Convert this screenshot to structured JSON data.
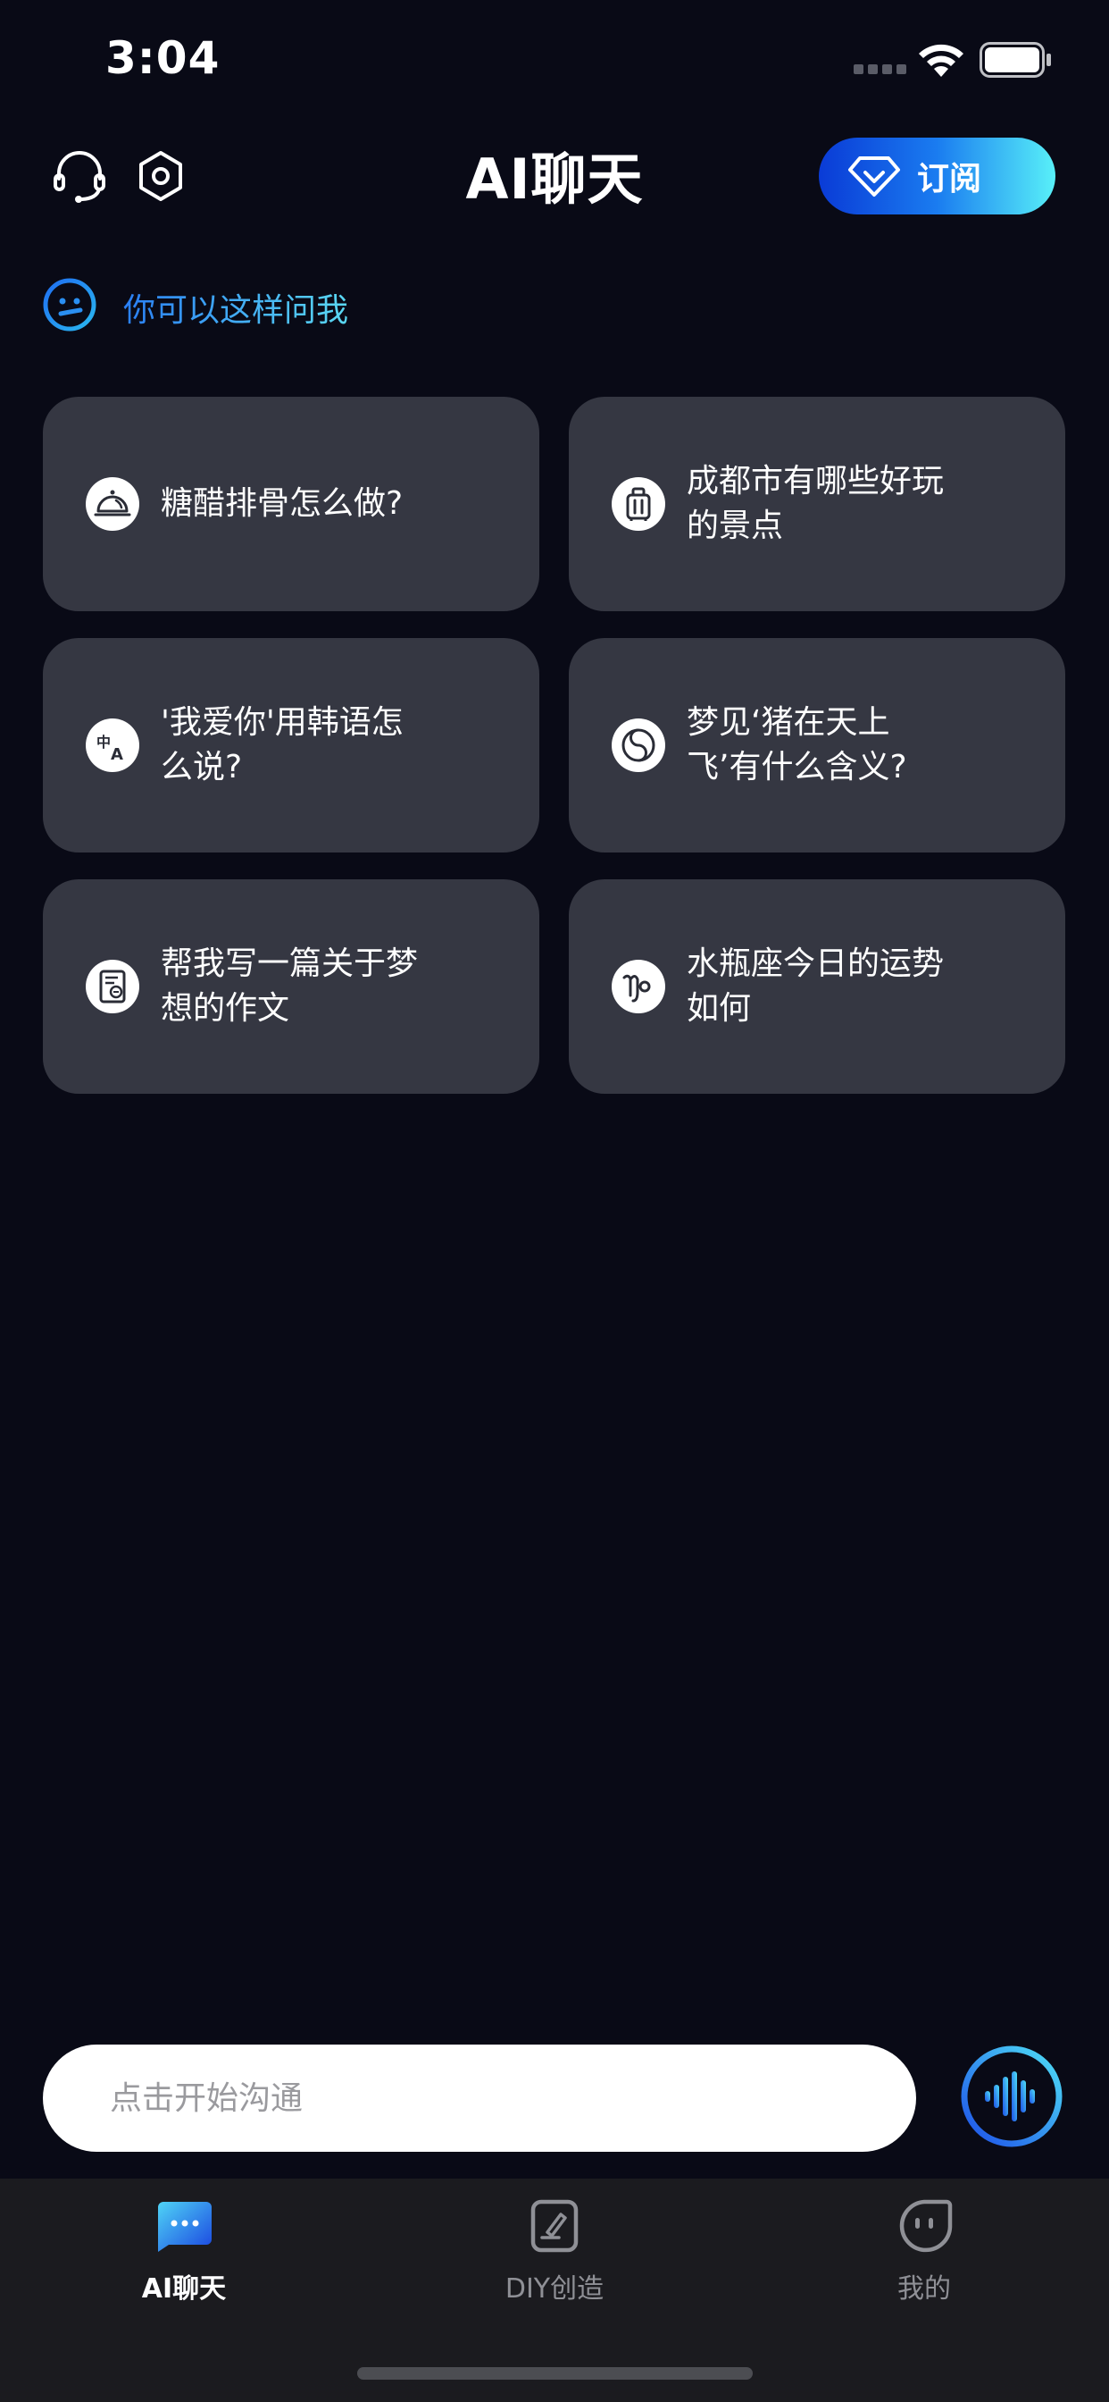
{
  "status_bar": {
    "time": "3:04"
  },
  "header": {
    "title": "AI聊天",
    "subscribe_label": "订阅"
  },
  "hint": {
    "text": "你可以这样问我"
  },
  "suggestions": [
    {
      "text": "糖醋排骨怎么做?",
      "icon": "food-cloche-icon"
    },
    {
      "text": "成都市有哪些好玩的景点",
      "icon": "luggage-icon"
    },
    {
      "text": "'我爱你'用韩语怎么说?",
      "icon": "translate-icon"
    },
    {
      "text": "梦见‘猪在天上飞’有什么含义?",
      "icon": "yin-yang-icon"
    },
    {
      "text": "帮我写一篇关于梦想的作文",
      "icon": "essay-document-icon"
    },
    {
      "text": "水瓶座今日的运势如何",
      "icon": "zodiac-icon"
    }
  ],
  "input": {
    "placeholder": "点击开始沟通"
  },
  "colors": {
    "background": "#090a16",
    "card": "#353742",
    "accent_start": "#0a3bd6",
    "accent_end": "#58f0f8",
    "tab_bar": "#1b1b1f"
  },
  "tabs": [
    {
      "label": "AI聊天",
      "active": true,
      "icon": "chat-bubble-icon"
    },
    {
      "label": "DIY创造",
      "active": false,
      "icon": "edit-pen-icon"
    },
    {
      "label": "我的",
      "active": false,
      "icon": "profile-face-icon"
    }
  ]
}
